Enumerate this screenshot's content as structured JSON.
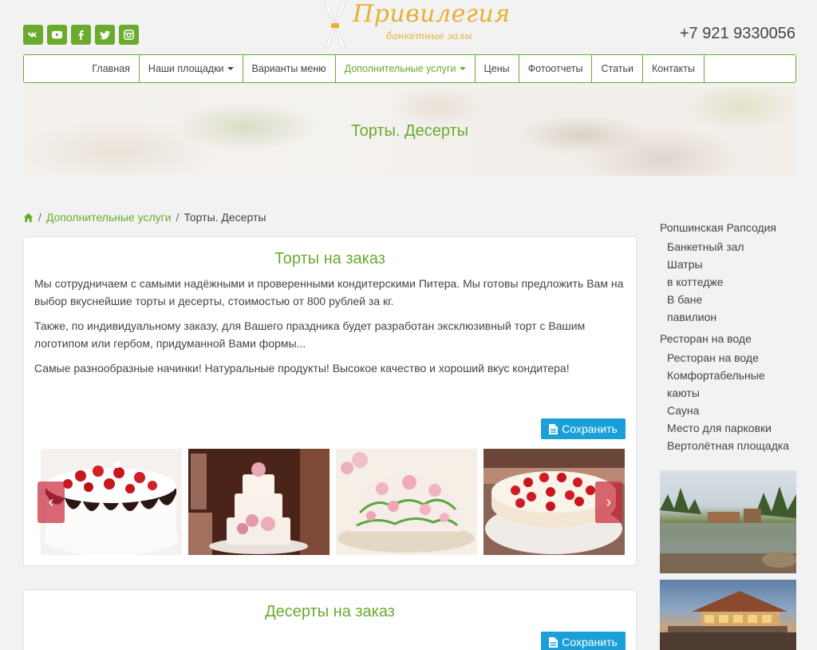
{
  "header": {
    "social": [
      "vk-icon",
      "youtube-icon",
      "facebook-icon",
      "twitter-icon",
      "instagram-icon"
    ],
    "logo_text": "Привилегия",
    "logo_sub": "банкетные залы",
    "phone": "+7 921 9330056"
  },
  "nav": {
    "items": [
      {
        "label": "Главная"
      },
      {
        "label": "Наши площадки"
      },
      {
        "label": "Варианты меню"
      },
      {
        "label": "Дополнительные услуги"
      },
      {
        "label": "Цены"
      },
      {
        "label": "Фотоотчеты"
      },
      {
        "label": "Статьи"
      },
      {
        "label": "Контакты"
      }
    ]
  },
  "banner": {
    "title": "Торты. Десерты"
  },
  "breadcrumb": {
    "parent": "Дополнительные услуги",
    "separator": "/",
    "current": "Торты. Десерты"
  },
  "panel1": {
    "title": "Торты на заказ",
    "p1": "Мы сотрудничаем с самыми надёжными и проверенными кондитерскими Питера. Мы готовы предложить Вам на выбор вкуснейшие торты и десерты, стоимостью от 800 рублей за кг.",
    "p2": "Также, по индивидуальному заказу, для Вашего праздника будет разработан эксклюзивный торт с Вашим логотипом или гербом, придуманной Вами формы...",
    "p3": "Самые разнообразные начинки! Натуральные продукты! Высокое качество и хороший вкус кондитера!",
    "save_label": "Сохранить",
    "prev": "‹",
    "next": "›"
  },
  "panel2": {
    "title": "Десерты на заказ",
    "save_label": "Сохранить"
  },
  "sidebar": {
    "groups": [
      {
        "title": "Ропшинская Рапсодия",
        "items": [
          "Банкетный зал",
          "Шатры",
          "в коттедже",
          "В бане",
          "павилион"
        ]
      },
      {
        "title": "Ресторан на воде",
        "items": [
          "Ресторан на воде",
          "Комфортабельные каюты",
          "Сауна",
          "Место для парковки",
          "Вертолётная площадка"
        ]
      }
    ]
  },
  "colors": {
    "accent": "#6aab2e",
    "button": "#1a9fd8",
    "logo": "#e6b030"
  }
}
